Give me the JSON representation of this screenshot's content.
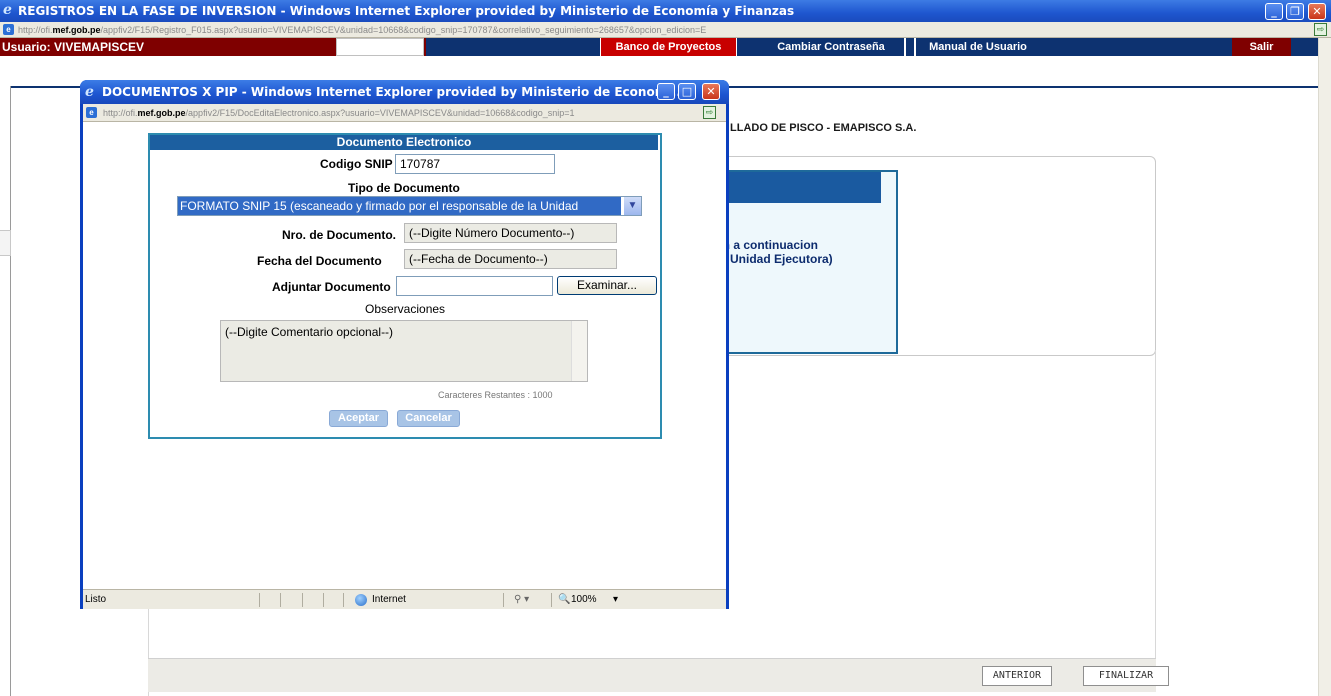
{
  "main_window": {
    "title": "REGISTROS EN LA FASE DE INVERSION - Windows Internet Explorer provided by Ministerio de Economía y Finanzas",
    "address_prefix": "http://ofi.",
    "address_host": "mef.gob.pe",
    "address_path": "/appfiv2/F15/Registro_F015.aspx?usuario=VIVEMAPISCEV&unidad=10668&codigo_snip=170787&correlativo_seguimiento=268657&opcion_edicion=E"
  },
  "nav": {
    "user_label": "Usuario: VIVEMAPISCEV",
    "items": [
      "Banco de Proyectos",
      "Cambiar Contraseña",
      "Manual de Usuario"
    ],
    "salir": "Salir"
  },
  "page": {
    "company_name": "LLADO DE PISCO - EMAPISCO S.A.",
    "inner_text_line1": "an a continuacion",
    "inner_text_line2": "Unidad Ejecutora)",
    "btn_anterior": "ANTERIOR",
    "btn_finalizar": "FINALIZAR"
  },
  "popup": {
    "title": "DOCUMENTOS X PIP - Windows Internet Explorer provided by Ministerio de Econom...",
    "address_prefix": "http://ofi.",
    "address_host": "mef.gob.pe",
    "address_path": "/appfiv2/F15/DocEditaElectronico.aspx?usuario=VIVEMAPISCEV&unidad=10668&codigo_snip=1",
    "status_text": "Listo",
    "zone": "Internet",
    "zoom": "100%"
  },
  "form": {
    "header": "Documento Electronico",
    "codigo_snip_label": "Codigo SNIP",
    "codigo_snip_value": "170787",
    "tipo_label": "Tipo de Documento",
    "tipo_selected": "FORMATO SNIP 15 (escaneado y firmado por el responsable de la Unidad",
    "nro_label": "Nro. de Documento.",
    "nro_placeholder": "(--Digite Número Documento--)",
    "fecha_label": "Fecha del Documento",
    "fecha_placeholder": "(--Fecha de Documento--)",
    "adjuntar_label": "Adjuntar Documento",
    "examinar": "Examinar...",
    "obs_label": "Observaciones",
    "obs_placeholder": "(--Digite Comentario opcional--)",
    "caracteres": "Caracteres Restantes : 1000",
    "aceptar": "Aceptar",
    "cancelar": "Cancelar"
  }
}
